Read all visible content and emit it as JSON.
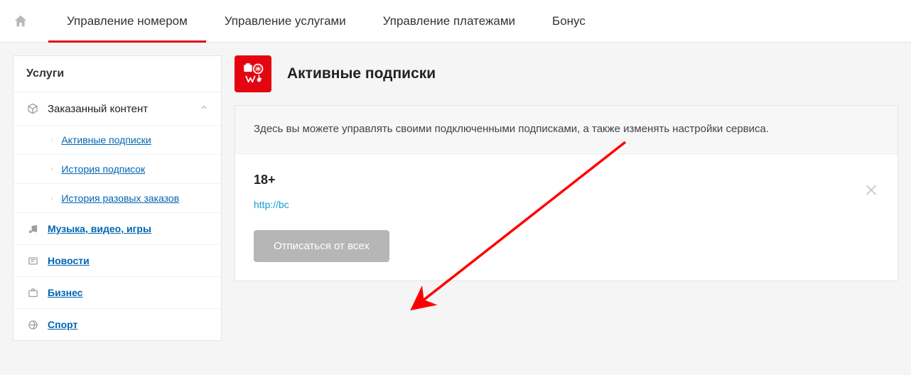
{
  "topnav": {
    "tabs": [
      {
        "label": "Управление номером",
        "active": true
      },
      {
        "label": "Управление услугами",
        "active": false
      },
      {
        "label": "Управление платежами",
        "active": false
      },
      {
        "label": "Бонус",
        "active": false
      }
    ]
  },
  "sidebar": {
    "header": "Услуги",
    "section_content": {
      "label": "Заказанный контент"
    },
    "sub_items": [
      {
        "label": "Активные подписки"
      },
      {
        "label": "История подписок"
      },
      {
        "label": "История разовых заказов"
      }
    ],
    "links": [
      {
        "label": "Музыка, видео, игры",
        "icon": "music"
      },
      {
        "label": "Новости",
        "icon": "news"
      },
      {
        "label": "Бизнес",
        "icon": "briefcase"
      },
      {
        "label": "Спорт",
        "icon": "sport"
      }
    ]
  },
  "main": {
    "title": "Активные подписки",
    "notice": "Здесь вы можете управлять своими подключенными подписками, а также изменять настройки сервиса.",
    "subscription": {
      "title": "18+",
      "link": "http://bc"
    },
    "unsubscribe_button": "Отписаться от всех"
  }
}
